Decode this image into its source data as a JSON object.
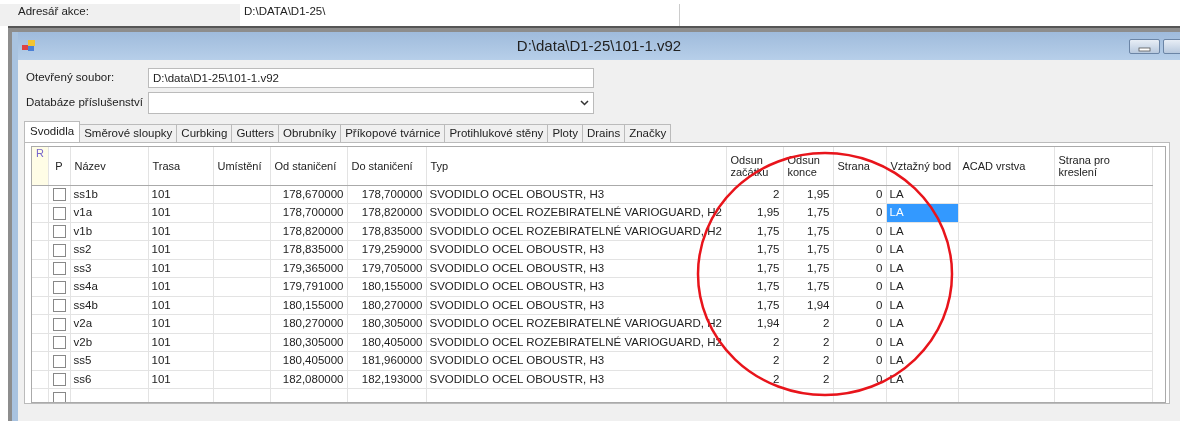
{
  "address_bar": {
    "label": "Adresář akce:",
    "value": "D:\\DATA\\D1-25\\"
  },
  "window": {
    "title": "D:\\data\\D1-25\\101-1.v92"
  },
  "form": {
    "file_label": "Otevřený soubor:",
    "file_value": "D:\\data\\D1-25\\101-1.v92",
    "db_label": "Databáze příslušenství"
  },
  "tabs": [
    {
      "label": "Svodidla",
      "selected": true
    },
    {
      "label": "Směrové sloupky",
      "selected": false
    },
    {
      "label": "Curbking",
      "selected": false
    },
    {
      "label": "Gutters",
      "selected": false
    },
    {
      "label": "Obrubníky",
      "selected": false
    },
    {
      "label": "Příkopové tvárnice",
      "selected": false
    },
    {
      "label": "Protihlukové stěny",
      "selected": false
    },
    {
      "label": "Ploty",
      "selected": false
    },
    {
      "label": "Drains",
      "selected": false
    },
    {
      "label": "Značky",
      "selected": false
    }
  ],
  "grid": {
    "corner": "R",
    "columns": [
      {
        "label": "P",
        "kind": "check"
      },
      {
        "label": "Název",
        "kind": "text"
      },
      {
        "label": "Trasa",
        "kind": "text"
      },
      {
        "label": "Umístění",
        "kind": "text"
      },
      {
        "label": "Od staničení",
        "kind": "number"
      },
      {
        "label": "Do staničení",
        "kind": "number"
      },
      {
        "label": "Typ",
        "kind": "text"
      },
      {
        "label": "Odsun začátku",
        "kind": "number"
      },
      {
        "label": "Odsun konce",
        "kind": "number"
      },
      {
        "label": "Strana",
        "kind": "number"
      },
      {
        "label": "Vztažný bod",
        "kind": "text"
      },
      {
        "label": "ACAD vrstva",
        "kind": "text"
      },
      {
        "label": "Strana pro kreslení",
        "kind": "text"
      }
    ],
    "rows": [
      {
        "selected": false,
        "cells": [
          {
            "checked": false
          },
          "ss1b",
          "101",
          "",
          "178,670000",
          "178,700000",
          "SVODIDLO OCEL OBOUSTR, H3",
          "2",
          "1,95",
          "0",
          "LA",
          "",
          ""
        ]
      },
      {
        "selected": true,
        "cells": [
          {
            "checked": false
          },
          "v1a",
          "101",
          "",
          "178,700000",
          "178,820000",
          "SVODIDLO OCEL ROZEBIRATELNÉ VARIOGUARD, H2",
          "1,95",
          "1,75",
          "0",
          "LA",
          "",
          ""
        ]
      },
      {
        "selected": false,
        "cells": [
          {
            "checked": false
          },
          "v1b",
          "101",
          "",
          "178,820000",
          "178,835000",
          "SVODIDLO OCEL ROZEBIRATELNÉ VARIOGUARD, H2",
          "1,75",
          "1,75",
          "0",
          "LA",
          "",
          ""
        ]
      },
      {
        "selected": false,
        "cells": [
          {
            "checked": false
          },
          "ss2",
          "101",
          "",
          "178,835000",
          "179,259000",
          "SVODIDLO OCEL OBOUSTR, H3",
          "1,75",
          "1,75",
          "0",
          "LA",
          "",
          ""
        ]
      },
      {
        "selected": false,
        "cells": [
          {
            "checked": false
          },
          "ss3",
          "101",
          "",
          "179,365000",
          "179,705000",
          "SVODIDLO OCEL OBOUSTR, H3",
          "1,75",
          "1,75",
          "0",
          "LA",
          "",
          ""
        ]
      },
      {
        "selected": false,
        "cells": [
          {
            "checked": false
          },
          "ss4a",
          "101",
          "",
          "179,791000",
          "180,155000",
          "SVODIDLO OCEL OBOUSTR, H3",
          "1,75",
          "1,75",
          "0",
          "LA",
          "",
          ""
        ]
      },
      {
        "selected": false,
        "cells": [
          {
            "checked": false
          },
          "ss4b",
          "101",
          "",
          "180,155000",
          "180,270000",
          "SVODIDLO OCEL OBOUSTR, H3",
          "1,75",
          "1,94",
          "0",
          "LA",
          "",
          ""
        ]
      },
      {
        "selected": false,
        "cells": [
          {
            "checked": false
          },
          "v2a",
          "101",
          "",
          "180,270000",
          "180,305000",
          "SVODIDLO OCEL ROZEBIRATELNÉ VARIOGUARD, H2",
          "1,94",
          "2",
          "0",
          "LA",
          "",
          ""
        ]
      },
      {
        "selected": false,
        "cells": [
          {
            "checked": false
          },
          "v2b",
          "101",
          "",
          "180,305000",
          "180,405000",
          "SVODIDLO OCEL ROZEBIRATELNÉ VARIOGUARD, H2",
          "2",
          "2",
          "0",
          "LA",
          "",
          ""
        ]
      },
      {
        "selected": false,
        "cells": [
          {
            "checked": false
          },
          "ss5",
          "101",
          "",
          "180,405000",
          "181,960000",
          "SVODIDLO OCEL OBOUSTR, H3",
          "2",
          "2",
          "0",
          "LA",
          "",
          ""
        ]
      },
      {
        "selected": false,
        "cells": [
          {
            "checked": false
          },
          "ss6",
          "101",
          "",
          "182,080000",
          "182,193000",
          "SVODIDLO OCEL OBOUSTR, H3",
          "2",
          "2",
          "0",
          "LA",
          "",
          ""
        ]
      }
    ],
    "new_row": {
      "checked": false
    }
  },
  "annotation": {
    "kind": "circle",
    "color": "#e8141b"
  }
}
